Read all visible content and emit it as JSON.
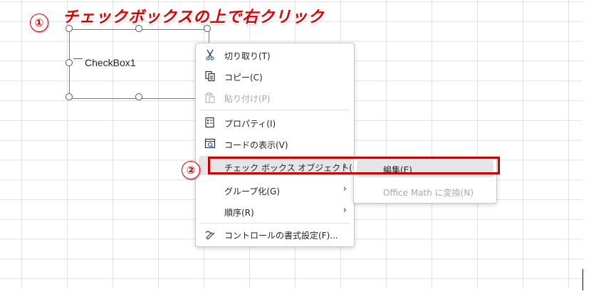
{
  "annotation": {
    "title": "チェックボックスの上で右クリック",
    "step1": "①",
    "step2": "②"
  },
  "checkbox": {
    "label": "CheckBox1"
  },
  "context_menu": {
    "cut": "切り取り(T)",
    "copy": "コピー(C)",
    "paste": "貼り付け(P)",
    "properties": "プロパティ(I)",
    "view_code": "コードの表示(V)",
    "checkbox_object": "チェック ボックス オブジェクト(O)",
    "group": "グループ化(G)",
    "order": "順序(R)",
    "format_control": "コントロールの書式設定(F)..."
  },
  "submenu": {
    "edit": "編集(E)",
    "office_math": "Office Math に変換(N)"
  },
  "colors": {
    "annotation_red": "#e00000",
    "highlight_gray": "#e5e5e5",
    "disabled_gray": "#a8a8a8"
  }
}
